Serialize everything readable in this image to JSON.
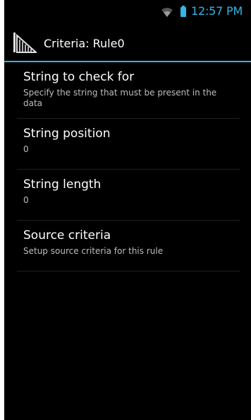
{
  "status_bar": {
    "time": "12:57 PM",
    "icons": [
      "wifi-icon",
      "battery-icon"
    ],
    "accent_color": "#33b5e5"
  },
  "action_bar": {
    "title": "Criteria: Rule0",
    "icon": "app-icon"
  },
  "preferences": [
    {
      "title": "String to check for",
      "summary": "Specify the string that must be present in the data"
    },
    {
      "title": "String position",
      "summary": "0"
    },
    {
      "title": "String length",
      "summary": "0"
    },
    {
      "title": "Source criteria",
      "summary": "Setup source criteria for this rule"
    }
  ]
}
